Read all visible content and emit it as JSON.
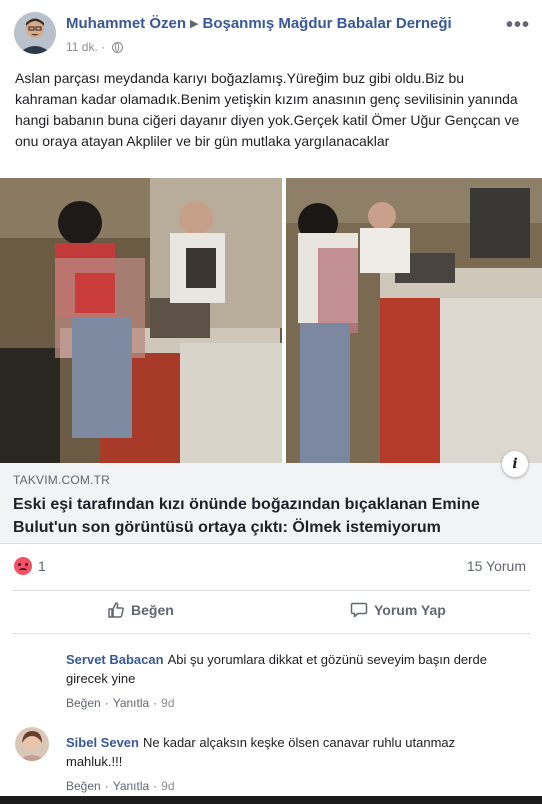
{
  "post": {
    "author": "Muhammet Özen",
    "group": "Boşanmış Mağdur Babalar Derneği",
    "time": "11 dk.",
    "privacy_icon": "globe-icon",
    "more_label": "•••",
    "text": "Aslan parçası meydanda karıyı boğazlamış.Yüreğim buz gibi oldu.Biz bu kahraman kadar olamadık.Benim yetişkin kızım anasının genç sevilisinin yanında hangi babanın buna ciğeri dayanır diyen yok.Gerçek katil Ömer Uğur Gençcan ve onu oraya atayan Akpliler ve bir gün mutlaka yargılanacaklar"
  },
  "link": {
    "domain": "TAKVIM.COM.TR",
    "title": "Eski eşi tarafından kızı önünde boğazından bıçaklanan Emine Bulut'un son görüntüsü ortaya çıktı: Ölmek istemiyorum",
    "info_label": "i"
  },
  "stats": {
    "reaction_icon": "angry-reaction-icon",
    "reaction_count": "1",
    "comment_count": "15 Yorum"
  },
  "actions": {
    "like_label": "Beğen",
    "comment_label": "Yorum Yap"
  },
  "comments": [
    {
      "name": "Servet Babacan",
      "text": "Abi şu yorumlara dikkat et gözünü seveyim başın derde girecek yine",
      "like_label": "Beğen",
      "reply_label": "Yanıtla",
      "time": "9d"
    },
    {
      "name": "Sibel Seven",
      "text": "Ne kadar alçaksın keşke ölsen canavar ruhlu utanmaz mahluk.!!!",
      "like_label": "Beğen",
      "reply_label": "Yanıtla",
      "time": "9d"
    }
  ],
  "colors": {
    "link_blue": "#385898",
    "meta_grey": "#606770",
    "reaction": "#f25268"
  }
}
